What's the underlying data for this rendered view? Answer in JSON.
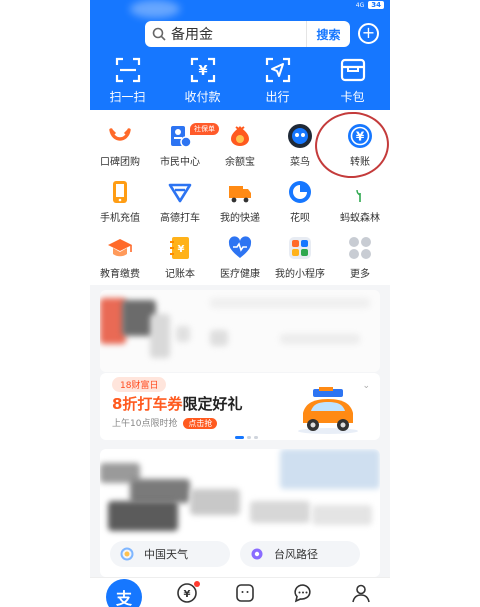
{
  "status": {
    "speed": "0.00\nKB/s",
    "network": "4G",
    "battery": "34"
  },
  "search": {
    "placeholder": "备用金",
    "button": "搜索"
  },
  "header": {
    "actions": [
      {
        "label": "扫一扫",
        "icon": "scan-icon"
      },
      {
        "label": "收付款",
        "icon": "payment-code-icon"
      },
      {
        "label": "出行",
        "icon": "travel-icon"
      },
      {
        "label": "卡包",
        "icon": "card-wallet-icon"
      }
    ]
  },
  "services": [
    {
      "label": "口碑团购",
      "icon": "koubei-icon"
    },
    {
      "label": "市民中心",
      "icon": "citizen-center-icon",
      "badge": "社保单"
    },
    {
      "label": "余额宝",
      "icon": "yuebao-icon"
    },
    {
      "label": "菜鸟",
      "icon": "cainiao-icon"
    },
    {
      "label": "转账",
      "icon": "transfer-icon"
    },
    {
      "label": "手机充值",
      "icon": "phone-recharge-icon"
    },
    {
      "label": "高德打车",
      "icon": "amap-taxi-icon"
    },
    {
      "label": "我的快递",
      "icon": "express-icon"
    },
    {
      "label": "花呗",
      "icon": "huabei-icon"
    },
    {
      "label": "蚂蚁森林",
      "icon": "ant-forest-icon"
    },
    {
      "label": "教育缴费",
      "icon": "education-icon"
    },
    {
      "label": "记账本",
      "icon": "ledger-icon"
    },
    {
      "label": "医疗健康",
      "icon": "health-icon"
    },
    {
      "label": "我的小程序",
      "icon": "mini-program-icon"
    },
    {
      "label": "更多",
      "icon": "more-grid-icon"
    }
  ],
  "promo": {
    "tag": "18财富日",
    "title_highlight": "8折打车券",
    "title_rest": "限定好礼",
    "subtitle": "上午10点限时抢",
    "button": "点击抢"
  },
  "news": {
    "pills": [
      {
        "label": "中国天气",
        "icon": "weather-icon"
      },
      {
        "label": "台风路径",
        "icon": "typhoon-icon"
      }
    ]
  },
  "tabs": [
    {
      "label": "支",
      "icon": "alipay-home-icon"
    },
    {
      "label": "¥",
      "icon": "wealth-icon"
    },
    {
      "label": "",
      "icon": "koubei-tab-icon"
    },
    {
      "label": "",
      "icon": "message-icon"
    },
    {
      "label": "",
      "icon": "profile-icon"
    }
  ],
  "colors": {
    "brand": "#1677ff",
    "accent": "#ff5a1f",
    "annotation": "#c43b3b"
  }
}
